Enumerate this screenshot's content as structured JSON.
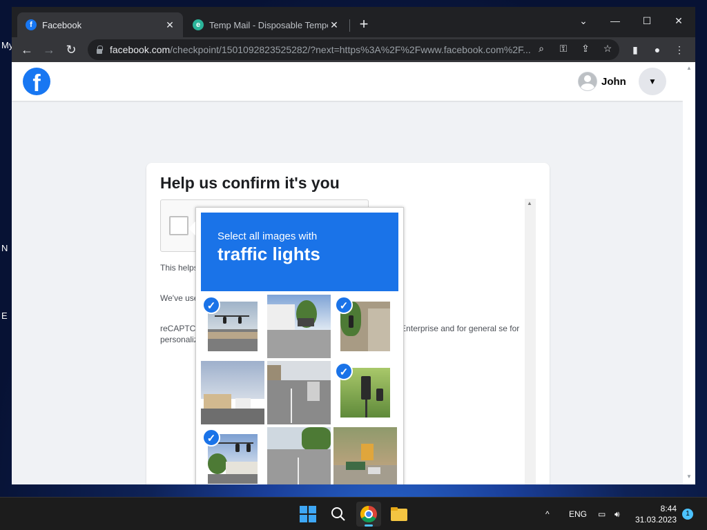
{
  "desktop": {
    "labels": [
      "My",
      "N",
      "E"
    ]
  },
  "browser": {
    "tabs": [
      {
        "title": "Facebook",
        "active": true
      },
      {
        "title": "Temp Mail - Disposable Tempora",
        "active": false
      }
    ],
    "window_controls": {
      "minimize": "—",
      "maximize": "☐",
      "close": "✕",
      "tab_search": "⌄"
    },
    "new_tab": "+",
    "toolbar": {
      "back": "←",
      "forward": "→",
      "reload": "↻"
    },
    "address": {
      "host": "facebook.com",
      "path": "/checkpoint/1501092823525282/?next=https%3A%2F%2Fwww.facebook.com%2F..."
    }
  },
  "facebook": {
    "logo": "f",
    "user_name": "John",
    "page_title": "Help us confirm it's you",
    "paragraphs": [
      "This helps                                                                                              and maintain the integrity of our Products.",
      "We've use                                                                                               is security check. Your use of reCAPTC                                                                                              Terms of Use.",
      "reCAPTC                                                                                                 n, such as device and application data, and                                                                                         CAPTCHA Enterprise and for general se                                                                                              for personalized advertising."
    ]
  },
  "recaptcha": {
    "instruction": "Select all images with",
    "target": "traffic lights",
    "tiles": [
      {
        "scene": "intersection-signals",
        "selected": true
      },
      {
        "scene": "street-palms-car",
        "selected": false
      },
      {
        "scene": "signal-building",
        "selected": true
      },
      {
        "scene": "street-bus-apartments",
        "selected": false
      },
      {
        "scene": "street-cars-parked",
        "selected": false
      },
      {
        "scene": "traffic-light-closeup",
        "selected": true
      },
      {
        "scene": "intersection-signals-trees",
        "selected": true
      },
      {
        "scene": "road-trees",
        "selected": false
      },
      {
        "scene": "road-sign-car",
        "selected": false
      }
    ],
    "check_glyph": "✓"
  },
  "taskbar": {
    "language": "ENG",
    "time": "8:44",
    "date": "31.03.2023",
    "notifications": "1"
  },
  "colors": {
    "facebook_blue": "#1877f2",
    "recaptcha_blue": "#1a73e8",
    "chrome_dark": "#202124"
  }
}
